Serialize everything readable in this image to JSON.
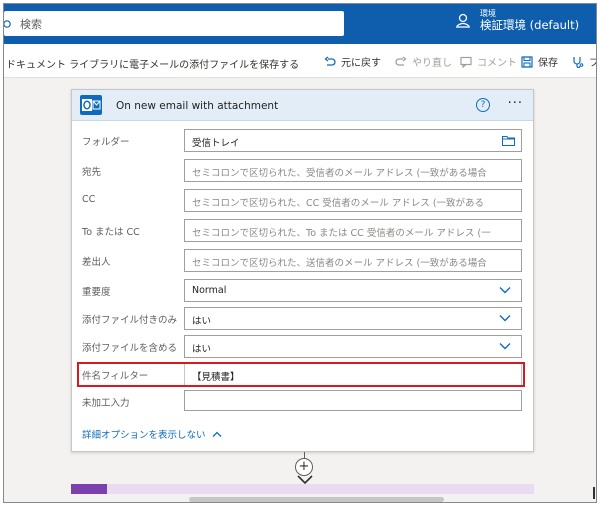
{
  "header": {
    "search_placeholder": "検索",
    "environment_label": "環境",
    "environment_name": "検証環境 (default)",
    "bg_color": "#0f5ead"
  },
  "commandbar": {
    "flow_name": "ドキュメント ライブラリに電子メールの添付ファイルを保存する",
    "undo": "元に戻す",
    "redo": "やり直し",
    "comment": "コメント",
    "save": "保存",
    "flow_checker": "フ"
  },
  "trigger": {
    "title": "On new email with attachment",
    "help": "?",
    "more": "···",
    "header_color": "#e3edf8",
    "fields": [
      {
        "label": "フォルダー",
        "value": "受信トレイ",
        "placeholder": "",
        "kind": "folder"
      },
      {
        "label": "宛先",
        "value": "",
        "placeholder": "セミコロンで区切られた、受信者のメール アドレス (一致がある場合",
        "kind": "text"
      },
      {
        "label": "CC",
        "value": "",
        "placeholder": "セミコロンで区切られた、CC 受信者のメール アドレス (一致がある",
        "kind": "text"
      },
      {
        "label": "To または CC",
        "value": "",
        "placeholder": "セミコロンで区切られた、To または CC 受信者のメール アドレス (一",
        "kind": "text"
      },
      {
        "label": "差出人",
        "value": "",
        "placeholder": "セミコロンで区切られた、送信者のメール アドレス (一致がある場合",
        "kind": "text"
      },
      {
        "label": "重要度",
        "value": "Normal",
        "placeholder": "",
        "kind": "dropdown"
      },
      {
        "label": "添付ファイル付きのみ",
        "value": "はい",
        "placeholder": "",
        "kind": "dropdown"
      },
      {
        "label": "添付ファイルを含める",
        "value": "はい",
        "placeholder": "",
        "kind": "dropdown"
      },
      {
        "label": "件名フィルター",
        "value": "【見積書】",
        "placeholder": "",
        "kind": "text"
      },
      {
        "label": "未加工入力",
        "value": "",
        "placeholder": "",
        "kind": "text"
      }
    ],
    "advanced_toggle": "詳細オプションを表示しない",
    "highlight_color": "#d71920"
  },
  "connector": {
    "plus": "+"
  },
  "next_action_color": "#e8dbf2"
}
